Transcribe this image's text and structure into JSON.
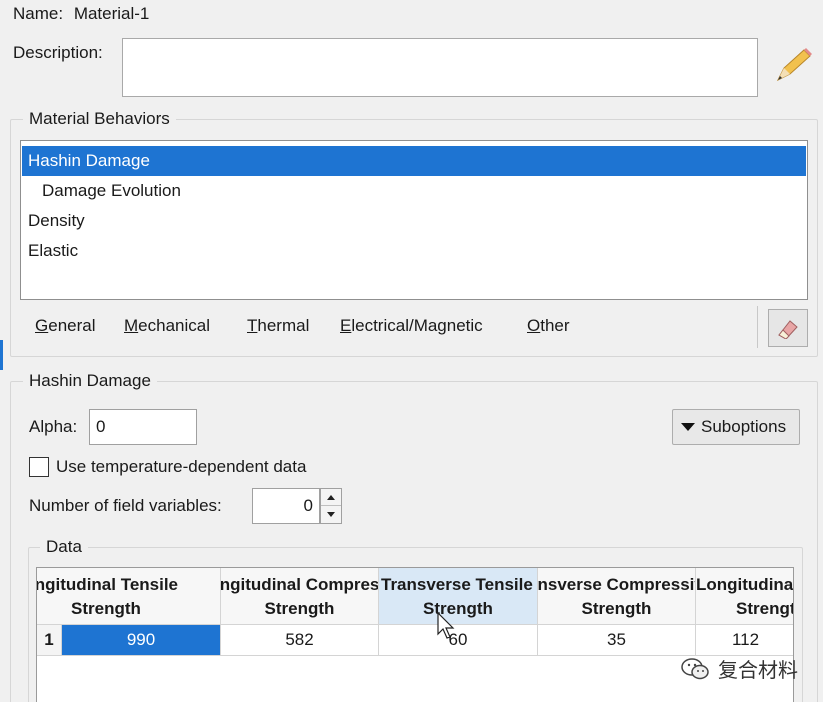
{
  "header": {
    "name_label": "Name:",
    "name_value": "Material-1",
    "description_label": "Description:",
    "description_value": ""
  },
  "material_behaviors": {
    "title": "Material Behaviors",
    "items": [
      {
        "label": "Hashin Damage",
        "selected": true,
        "indent": 0
      },
      {
        "label": "Damage Evolution",
        "selected": false,
        "indent": 1
      },
      {
        "label": "Density",
        "selected": false,
        "indent": 0
      },
      {
        "label": "Elastic",
        "selected": false,
        "indent": 0
      }
    ],
    "menus": [
      {
        "label": "General",
        "mnemonic": "G"
      },
      {
        "label": "Mechanical",
        "mnemonic": "M"
      },
      {
        "label": "Thermal",
        "mnemonic": "T"
      },
      {
        "label": "Electrical/Magnetic",
        "mnemonic": "E"
      },
      {
        "label": "Other",
        "mnemonic": "O"
      }
    ]
  },
  "hashin": {
    "title": "Hashin Damage",
    "alpha_label": "Alpha:",
    "alpha_value": "0",
    "suboptions_label": "Suboptions",
    "temp_dep_label": "Use temperature-dependent data",
    "temp_dep_checked": false,
    "nfv_label": "Number of field variables:",
    "nfv_value": "0"
  },
  "data_table": {
    "title": "Data",
    "columns": [
      {
        "line1": "Longitudinal Tensile",
        "line2": "Strength"
      },
      {
        "line1": "Longitudinal Compressive",
        "line2": "Strength"
      },
      {
        "line1": "Transverse Tensile",
        "line2": "Strength"
      },
      {
        "line1": "Transverse Compressive",
        "line2": "Strength"
      },
      {
        "line1": "Longitudinal",
        "line2": "Strength"
      }
    ],
    "rows": [
      {
        "num": "1",
        "cells": [
          "990",
          "582",
          "60",
          "35",
          "112"
        ]
      }
    ]
  },
  "watermark": {
    "text": "复合材料"
  },
  "colors": {
    "selection": "#1e74d2",
    "background": "#f0f0f0"
  }
}
